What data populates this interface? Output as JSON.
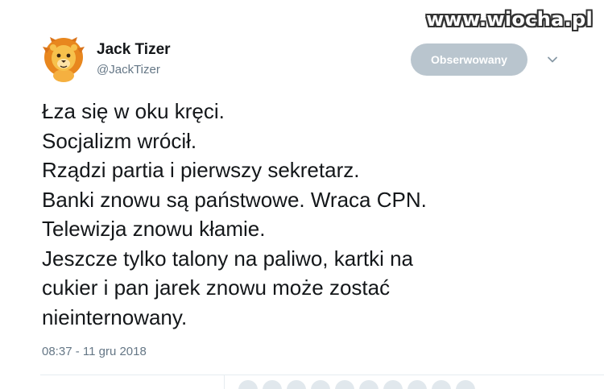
{
  "watermark": "www.wiocha.pl",
  "author": {
    "name": "Jack Tizer",
    "handle": "@JackTizer",
    "avatar_icon": "lion-avatar-icon"
  },
  "follow_button": {
    "label": "Obserwowany"
  },
  "menu_icon": "chevron-down-icon",
  "tweet": {
    "lines": [
      "Łza się w oku kręci.",
      "Socjalizm wrócił.",
      "Rządzi partia i pierwszy sekretarz.",
      "Banki znowu są państwowe. Wraca CPN.",
      "Telewizja znowu kłamie.",
      "Jeszcze tylko talony na paliwo, kartki na",
      "cukier i pan jarek znowu może zostać",
      "nieinternowany."
    ],
    "timestamp": "08:37 - 11 gru 2018"
  },
  "colors": {
    "text": "#14171a",
    "secondary": "#657786",
    "button_bg": "#b9c5ce"
  }
}
